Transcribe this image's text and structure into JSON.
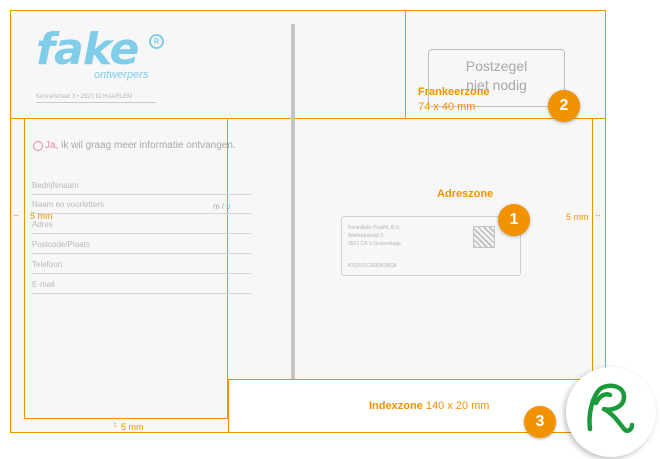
{
  "logo": {
    "word": "fake",
    "sub": "ontwerpers",
    "mark": "R",
    "address": "Kennetstraat 3 • 2920 ID HAARLEM"
  },
  "stamp": {
    "line1": "Postzegel",
    "line2": "niet nodig"
  },
  "form": {
    "checkbox_ja": "Ja,",
    "checkbox_text": "ik wil graag meer informatie ontvangen.",
    "fields": [
      "Bedrijfsnaam",
      "Naam en voorletters",
      "Adres",
      "Postcode/Plaats",
      "Telefoon",
      "E-mail"
    ],
    "gender": "m / v"
  },
  "address": {
    "lines": [
      "Koninklijke PostNL B.V.",
      "Waldorpstraat 3",
      "2521 CA 's Gravenhage",
      "KIX2521CA3DK1BQ4"
    ]
  },
  "zones": {
    "franking": {
      "title": "Frankeerzone",
      "size": "74 x 40 mm"
    },
    "address": {
      "title": "Adreszone"
    },
    "index": {
      "title": "Indexzone",
      "size": "140 x 20 mm"
    }
  },
  "badges": [
    "1",
    "2",
    "3"
  ],
  "margins": {
    "left": "5 mm",
    "right": "5 mm",
    "bottom": "5 mm"
  },
  "corner_icon": "green-r-logo-icon",
  "colors": {
    "accent": "#f29200",
    "logo": "#7fcde8",
    "corner": "#1a9a3a"
  }
}
